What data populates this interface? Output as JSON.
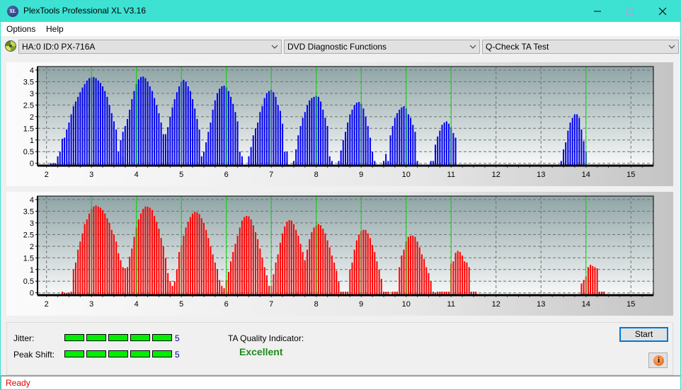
{
  "window": {
    "title": "PlexTools Professional XL V3.16",
    "icon": "xl-logo-icon",
    "controls": [
      "minimize-icon",
      "maximize-icon",
      "close-icon"
    ]
  },
  "menu": {
    "items": [
      "Options",
      "Help"
    ]
  },
  "toolbar": {
    "drive": "HA:0 ID:0  PX-716A",
    "function": "DVD Diagnostic Functions",
    "test": "Q-Check TA Test"
  },
  "metrics": {
    "jitter_label": "Jitter:",
    "jitter_value": "5",
    "jitter_level": 5,
    "peak_shift_label": "Peak Shift:",
    "peak_shift_value": "5",
    "peak_shift_level": 5,
    "quality_label": "TA Quality Indicator:",
    "quality_value": "Excellent"
  },
  "buttons": {
    "start": "Start",
    "info_icon": "info-icon"
  },
  "status": {
    "text": "Ready"
  },
  "colors": {
    "top_bars": "#0000ee",
    "bottom_bars": "#ff0000",
    "marker": "#00e000",
    "quality": "#1e8a1e",
    "status": "#e00000"
  },
  "chart_data": [
    {
      "type": "bar",
      "name": "top-chart",
      "xlim": [
        1.8,
        15.5
      ],
      "ylim": [
        -0.1,
        4.15
      ],
      "xticks": [
        "2",
        "3",
        "4",
        "5",
        "6",
        "7",
        "8",
        "9",
        "10",
        "11",
        "12",
        "13",
        "14",
        "15"
      ],
      "yticks": [
        "0",
        "0.5",
        "1",
        "1.5",
        "2",
        "2.5",
        "3",
        "3.5",
        "4"
      ],
      "markers": [
        3,
        4,
        5,
        6,
        7,
        8,
        9,
        10,
        11,
        14
      ],
      "grid": true,
      "bar_step": 0.05,
      "segments": [
        {
          "start": 2.1,
          "values": [
            0,
            0,
            0,
            0.3,
            0.5,
            1.05,
            1.1,
            1.45,
            1.75,
            2.1,
            2.45,
            2.65,
            2.85,
            3.05,
            3.25,
            3.4,
            3.55,
            3.65,
            3.68,
            3.7,
            3.65,
            3.55,
            3.45,
            3.3,
            3.1,
            2.85,
            2.5,
            2.15,
            1.8,
            1.45,
            0.5,
            0.3,
            0.3
          ]
        },
        {
          "start": 3.65,
          "values": [
            1.0,
            1.35,
            1.6,
            1.9,
            2.3,
            2.75,
            3.1,
            3.4,
            3.6,
            3.7,
            3.72,
            3.65,
            3.5,
            3.3,
            3.1,
            2.8,
            2.5,
            2.15,
            1.75,
            1.25,
            0.3,
            0.5
          ]
        },
        {
          "start": 4.55,
          "values": [
            0,
            0,
            1.25,
            1.55,
            2.0,
            2.4,
            2.75,
            3.05,
            3.3,
            3.5,
            3.58,
            3.5,
            3.3,
            3.1,
            2.75,
            2.35,
            1.9,
            1.45,
            0.3,
            0.1
          ]
        },
        {
          "start": 5.5,
          "values": [
            0.5,
            0.9,
            1.35,
            1.75,
            2.3,
            2.7,
            3.0,
            3.2,
            3.3,
            3.33,
            3.25,
            3.1,
            2.85,
            2.55,
            2.2,
            1.8,
            0.5,
            0.3
          ]
        },
        {
          "start": 6.5,
          "values": [
            0.3,
            0.7,
            1.2,
            1.5,
            1.75,
            2.2,
            2.45,
            2.8,
            3.0,
            3.1,
            3.15,
            3.05,
            2.85,
            2.5,
            2.25,
            1.7,
            0.5,
            0.5
          ]
        },
        {
          "start": 7.5,
          "values": [
            0.1,
            0.6,
            1.2,
            1.6,
            1.95,
            2.2,
            2.5,
            2.7,
            2.8,
            2.85,
            2.9,
            2.85,
            2.65,
            2.3,
            1.95,
            1.6,
            0.3,
            0.1
          ]
        },
        {
          "start": 8.5,
          "values": [
            0.1,
            0.55,
            1.0,
            1.35,
            1.75,
            2.1,
            2.3,
            2.5,
            2.6,
            2.63,
            2.55,
            2.35,
            2.0,
            1.6,
            1.1,
            0.5,
            0.1
          ]
        },
        {
          "start": 9.5,
          "values": [
            0.1,
            0.4,
            0.1,
            1.2,
            1.6,
            1.95,
            2.15,
            2.3,
            2.4,
            2.45,
            2.35,
            2.1,
            1.95,
            1.65,
            1.35,
            0.1
          ]
        },
        {
          "start": 10.55,
          "values": [
            0.1,
            0.1,
            0.8,
            1.15,
            1.4,
            1.65,
            1.75,
            1.8,
            1.7,
            1.55,
            1.3,
            1.1
          ]
        },
        {
          "start": 13.45,
          "values": [
            0.1,
            0.6,
            0.9,
            1.4,
            1.75,
            1.95,
            2.1,
            2.1,
            1.95,
            1.45,
            0.95,
            0.5
          ]
        }
      ]
    },
    {
      "type": "bar",
      "name": "bottom-chart",
      "xlim": [
        1.8,
        15.5
      ],
      "ylim": [
        -0.1,
        4.15
      ],
      "xticks": [
        "2",
        "3",
        "4",
        "5",
        "6",
        "7",
        "8",
        "9",
        "10",
        "11",
        "12",
        "13",
        "14",
        "15"
      ],
      "yticks": [
        "0",
        "0.5",
        "1",
        "1.5",
        "2",
        "2.5",
        "3",
        "3.5",
        "4"
      ],
      "markers": [
        3,
        4,
        5,
        6,
        7,
        8,
        9,
        10,
        11,
        14
      ],
      "grid": true,
      "bar_step": 0.05,
      "segments": [
        {
          "start": 2.35,
          "values": [
            0.05,
            0,
            0,
            0,
            0.05,
            1.0,
            1.3,
            1.85,
            2.2,
            2.55,
            2.95,
            3.15,
            3.4,
            3.6,
            3.7,
            3.75,
            3.7,
            3.65,
            3.55,
            3.4,
            3.2,
            3.0,
            2.7,
            2.5,
            2.2,
            1.7,
            1.4,
            1.1,
            1.05,
            1.1,
            1.55,
            1.9,
            2.4,
            2.8,
            3.15,
            3.4,
            3.6,
            3.7,
            3.7,
            3.65,
            3.55,
            3.3,
            3.05,
            2.75,
            2.35,
            2.0,
            1.5,
            0.85,
            0.5,
            0.3,
            0.5,
            1.0,
            1.75,
            2.05,
            2.45,
            2.8,
            3.05,
            3.25,
            3.4,
            3.48,
            3.45,
            3.38,
            3.2,
            3.0,
            2.7,
            2.35,
            2.0,
            1.65,
            1.3,
            1.0,
            0.55,
            0.3,
            0.2,
            0.55,
            0.9,
            1.35,
            1.75,
            2.1,
            2.45,
            2.8,
            3.1,
            3.25,
            3.3,
            3.28,
            3.15,
            2.9,
            2.6,
            2.3,
            1.9,
            1.5,
            1.1,
            0.75,
            0.3,
            0.3,
            0.8,
            1.3,
            1.65,
            2.15,
            2.55,
            2.85,
            3.05,
            3.12,
            3.1,
            2.95,
            2.7,
            2.45,
            2.1,
            1.75,
            1.4,
            1.1,
            0.5
          ]
        },
        {
          "start": 7.55,
          "values": [
            0.05,
            0.05,
            0.05,
            1.0,
            1.3,
            1.85,
            2.3,
            2.6,
            2.8,
            2.9,
            2.95,
            2.9,
            2.75,
            2.55,
            2.25,
            1.95,
            1.6,
            1.3,
            0.95,
            0.5,
            0.05
          ]
        },
        {
          "start": 8.6,
          "values": [
            0.05,
            0.05,
            0.05,
            1.0,
            1.3,
            1.85,
            2.25,
            2.5,
            2.65,
            2.7,
            2.7,
            2.55,
            2.35,
            2.05,
            1.75,
            1.35,
            1.0,
            0.6,
            0.05,
            0.05,
            0.05
          ]
        },
        {
          "start": 9.7,
          "values": [
            0.05,
            0.05,
            0.05,
            1.1,
            1.6,
            1.85,
            2.2,
            2.4,
            2.45,
            2.45,
            2.4,
            2.2,
            1.95,
            1.65,
            1.45,
            1.1,
            0.85,
            0.5,
            0.05,
            0,
            0.05
          ]
        },
        {
          "start": 10.75,
          "values": [
            0.05,
            0.05,
            0.05,
            0.05,
            0.05,
            1.25,
            1.35,
            1.72,
            1.8,
            1.75,
            1.6,
            1.35,
            1.3,
            1.1,
            0.05,
            0.05,
            0.05
          ]
        },
        {
          "start": 13.9,
          "values": [
            0.4,
            0.55,
            0.7,
            1.1,
            1.2,
            1.15,
            1.1,
            1.05,
            0.05,
            0.05,
            0.05
          ]
        }
      ]
    }
  ]
}
